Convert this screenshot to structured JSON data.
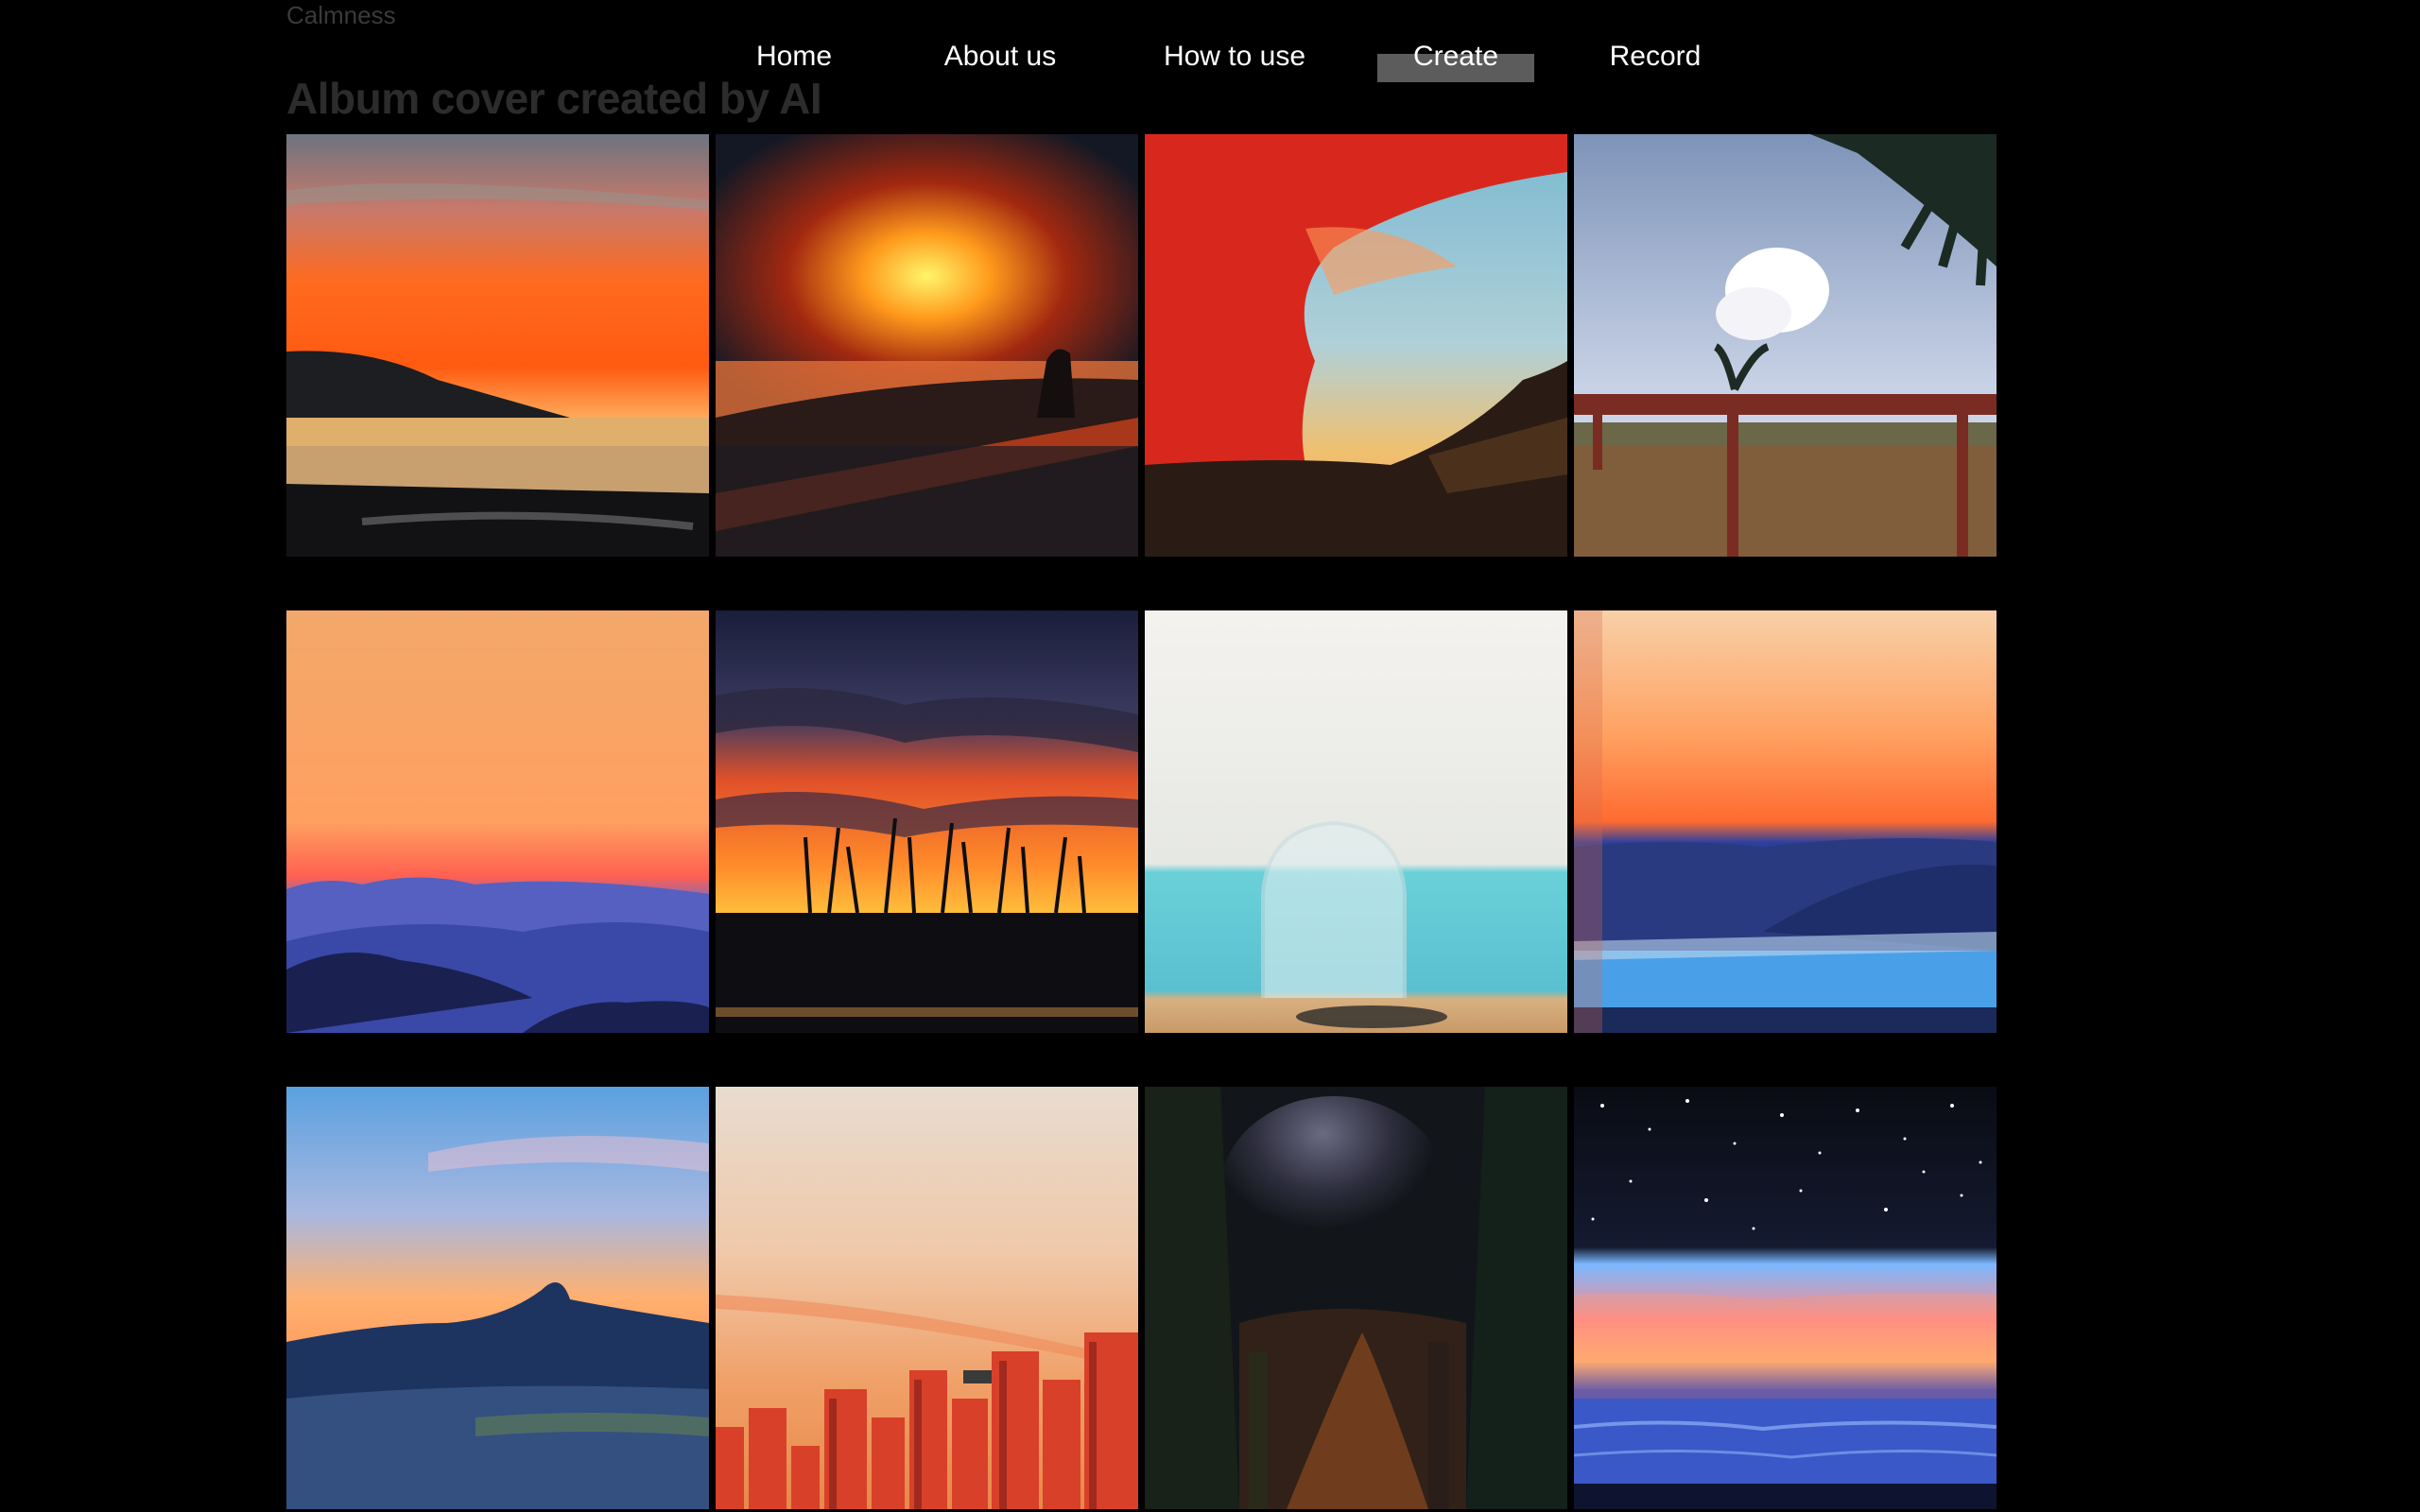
{
  "brand": "Calmness",
  "page_title": "Album cover created by AI",
  "nav": {
    "items": [
      {
        "label": "Home",
        "active": false
      },
      {
        "label": "About us",
        "active": false
      },
      {
        "label": "How to use",
        "active": false
      },
      {
        "label": "Create",
        "active": true
      },
      {
        "label": "Record",
        "active": false
      }
    ]
  },
  "colors": {
    "background": "#000000",
    "brand_text": "#3a3a3a",
    "title_text": "#2c2c2c",
    "nav_active_bg": "#5c5c5c"
  },
  "gallery": {
    "tiles": [
      {
        "subject": "sunset-over-lake"
      },
      {
        "subject": "sunset-beach-figure"
      },
      {
        "subject": "red-cloud-cliff"
      },
      {
        "subject": "palm-and-pergola"
      },
      {
        "subject": "blue-mountain-dusk"
      },
      {
        "subject": "sunset-reeds-silhouette"
      },
      {
        "subject": "pale-sea-dome"
      },
      {
        "subject": "coastal-town-dusk"
      },
      {
        "subject": "mountain-peak-sky"
      },
      {
        "subject": "orange-city-skyline"
      },
      {
        "subject": "dark-forest-path"
      },
      {
        "subject": "starry-sea-horizon"
      }
    ]
  }
}
